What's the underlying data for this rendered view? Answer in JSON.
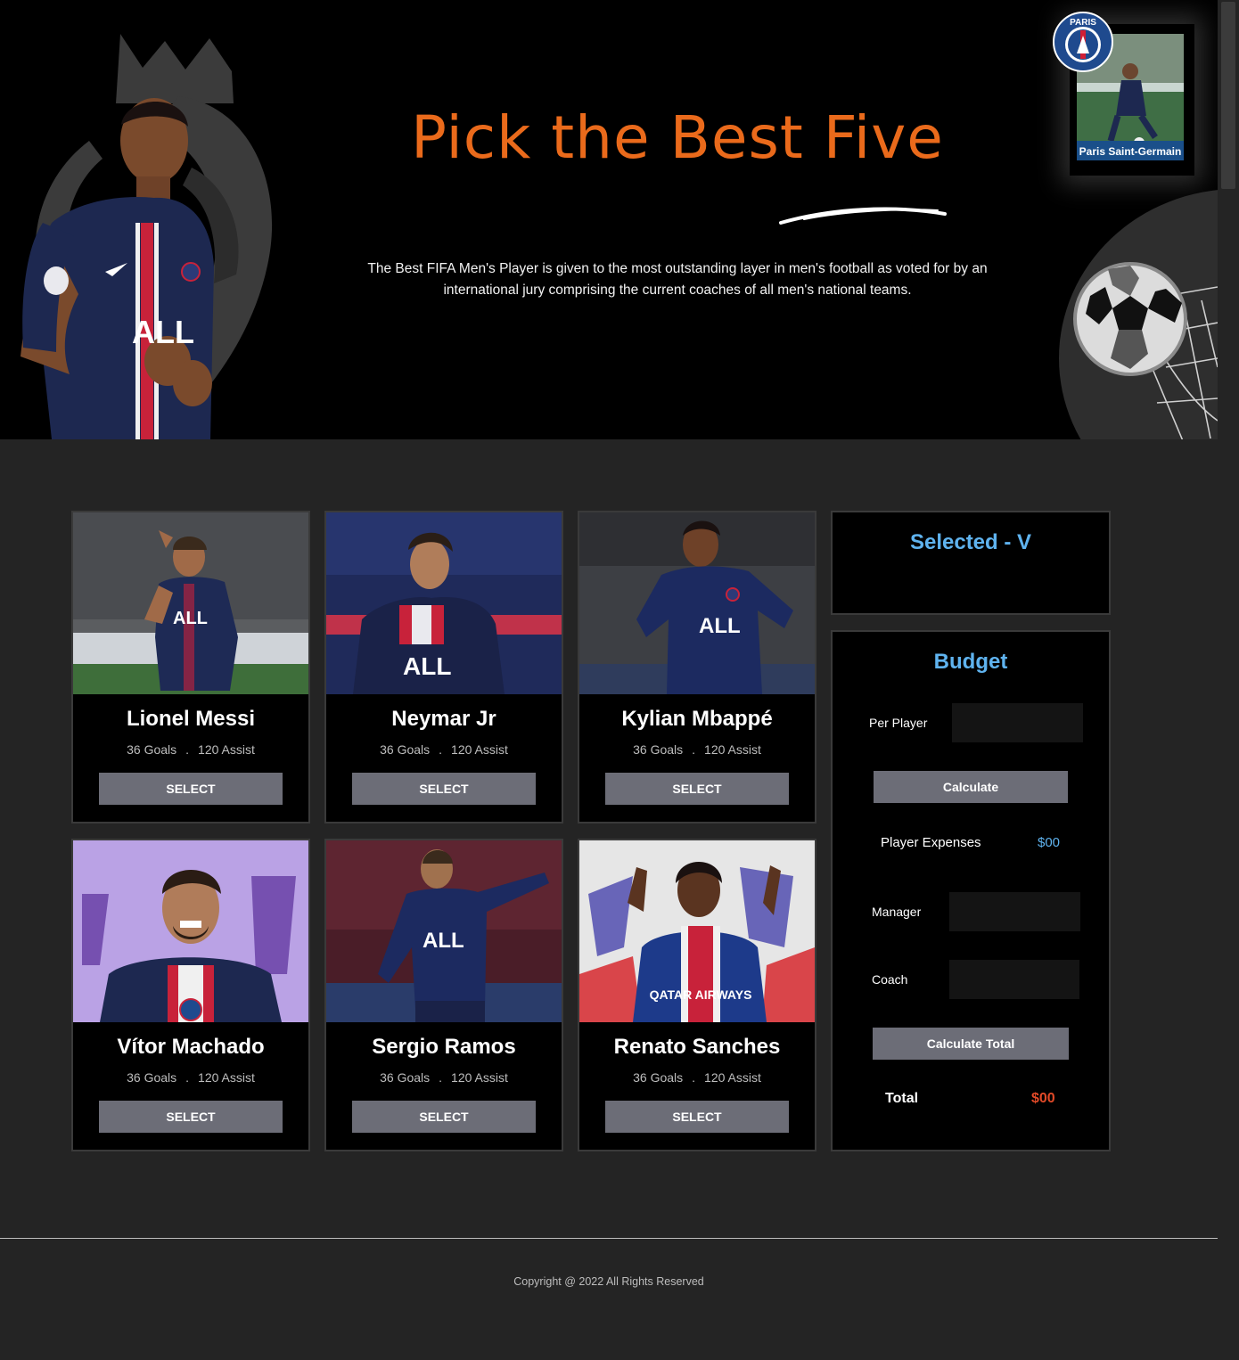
{
  "hero": {
    "title": "Pick the Best Five",
    "description": "The Best FIFA Men's Player is given to the most outstanding layer in men's football as voted for by an international jury comprising the current coaches of all men's national teams.",
    "club_card_caption": "Paris Saint-Germain",
    "club_badge_text": "PARIS"
  },
  "players": [
    {
      "name": "Lionel Messi",
      "goals": "36 Goals",
      "assist": "120 Assist",
      "button": "SELECT",
      "jersey_text": "ALL"
    },
    {
      "name": "Neymar Jr",
      "goals": "36 Goals",
      "assist": "120 Assist",
      "button": "SELECT",
      "jersey_text": "ALL"
    },
    {
      "name": "Kylian Mbappé",
      "goals": "36 Goals",
      "assist": "120 Assist",
      "button": "SELECT",
      "jersey_text": "ALL"
    },
    {
      "name": "Vítor Machado",
      "goals": "36 Goals",
      "assist": "120 Assist",
      "button": "SELECT",
      "jersey_text": ""
    },
    {
      "name": "Sergio Ramos",
      "goals": "36 Goals",
      "assist": "120 Assist",
      "button": "SELECT",
      "jersey_text": "ALL"
    },
    {
      "name": "Renato Sanches",
      "goals": "36 Goals",
      "assist": "120 Assist",
      "button": "SELECT",
      "jersey_text": "QATAR AIRWAYS"
    }
  ],
  "selected_panel": {
    "title": "Selected - V"
  },
  "budget": {
    "title": "Budget",
    "per_player_label": "Per Player",
    "per_player_value": "",
    "calculate_label": "Calculate",
    "player_expenses_label": "Player Expenses",
    "player_expenses_value": "$00",
    "manager_label": "Manager",
    "manager_value": "",
    "coach_label": "Coach",
    "coach_value": "",
    "calculate_total_label": "Calculate Total",
    "total_label": "Total",
    "total_value": "$00"
  },
  "footer": {
    "copyright": "Copyright @ 2022 All Rights Reserved"
  },
  "colors": {
    "accent_orange": "#ea6a1b",
    "panel_blue": "#5fb3ef",
    "total_red": "#e24a28",
    "button_gray": "#6c6d77",
    "page_bg": "#242424"
  }
}
